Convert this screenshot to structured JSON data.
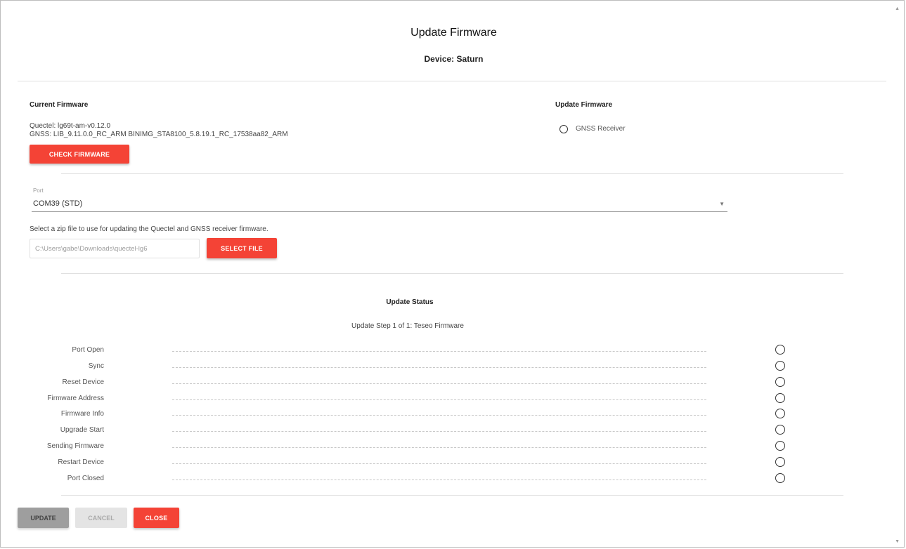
{
  "dialog": {
    "title": "Update Firmware",
    "device": "Device: Saturn"
  },
  "current_firmware": {
    "heading": "Current Firmware",
    "quectel": "Quectel: lg69t-am-v0.12.0",
    "gnss": "GNSS: LIB_9.11.0.0_RC_ARM BINIMG_STA8100_5.8.19.1_RC_17538aa82_ARM",
    "check_button": "CHECK FIRMWARE"
  },
  "update_firmware": {
    "heading": "Update Firmware",
    "option_label": "GNSS Receiver"
  },
  "port": {
    "label": "Port",
    "value": "COM39 (STD)"
  },
  "file": {
    "hint": "Select a zip file to use for updating the Quectel and GNSS receiver firmware.",
    "path": "C:\\Users\\gabe\\Downloads\\quectel-lg6",
    "select_button": "SELECT FILE"
  },
  "status": {
    "heading": "Update Status",
    "step_text": "Update Step 1 of 1: Teseo Firmware",
    "steps": [
      "Port Open",
      "Sync",
      "Reset Device",
      "Firmware Address",
      "Firmware Info",
      "Upgrade Start",
      "Sending Firmware",
      "Restart Device",
      "Port Closed"
    ]
  },
  "footer": {
    "update": "UPDATE",
    "cancel": "CANCEL",
    "close": "CLOSE"
  },
  "colors": {
    "accent": "#f44336",
    "disabled_update": "#9e9e9e",
    "disabled_cancel": "#e0e0e0"
  }
}
